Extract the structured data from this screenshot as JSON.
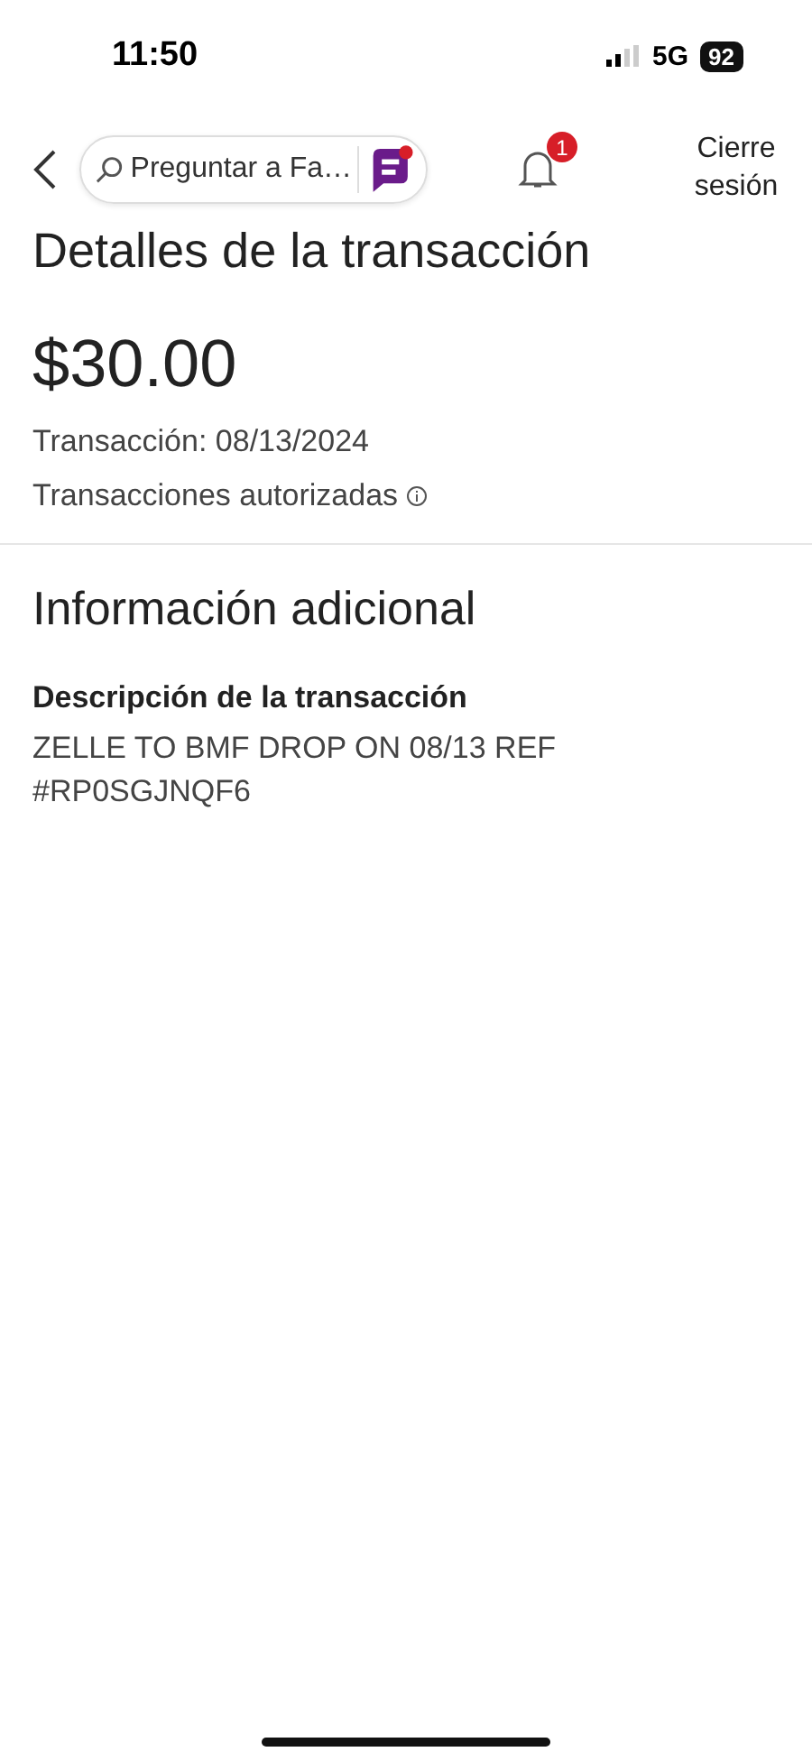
{
  "status_bar": {
    "time": "11:50",
    "network": "5G",
    "battery": "92"
  },
  "header": {
    "search": {
      "placeholder": "Preguntar a Fa…"
    },
    "notifications": {
      "count": "1"
    },
    "logout": "Cierre sesión"
  },
  "title": "Detalles de la transacción",
  "amount": "$30.00",
  "date": "Transacción: 08/13/2024",
  "status": "Transacciones autorizadas",
  "additional": {
    "title": "Información adicional",
    "label": "Descripción de la transacción",
    "description": "ZELLE TO BMF DROP ON 08/13 REF #RP0SGJNQF6"
  }
}
